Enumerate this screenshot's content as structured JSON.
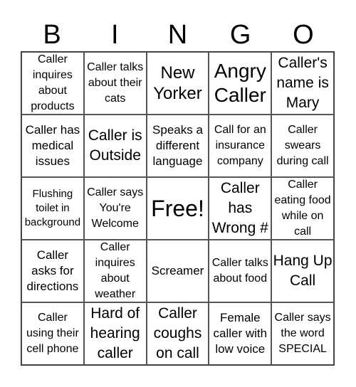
{
  "header": [
    "B",
    "I",
    "N",
    "G",
    "O"
  ],
  "cells": [
    "Caller inquires about products",
    "Caller talks about their cats",
    "New Yorker",
    "Angry Caller",
    "Caller's name is Mary",
    "Caller has medical issues",
    "Caller is Outside",
    "Speaks a different language",
    "Call for an insurance company",
    "Caller swears during call",
    "Flushing toilet in background",
    "Caller says You're Welcome",
    "Free!",
    "Caller has Wrong #",
    "Caller eating food while on call",
    "Caller asks for directions",
    "Caller inquires about weather",
    "Screamer",
    "Caller talks about food",
    "Hang Up Call",
    "Caller using their cell phone",
    "Hard of hearing caller",
    "Caller coughs on call",
    "Female caller with low voice",
    "Caller says the word SPECIAL"
  ]
}
